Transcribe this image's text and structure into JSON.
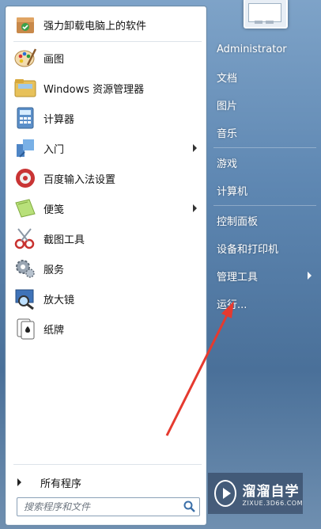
{
  "programs": [
    {
      "label": "强力卸载电脑上的软件",
      "icon": "uninstaller-icon",
      "has_submenu": false
    },
    {
      "label": "画图",
      "icon": "paint-icon",
      "has_submenu": false
    },
    {
      "label": "Windows 资源管理器",
      "icon": "explorer-folder-icon",
      "has_submenu": false
    },
    {
      "label": "计算器",
      "icon": "calculator-icon",
      "has_submenu": false
    },
    {
      "label": "入门",
      "icon": "getting-started-icon",
      "has_submenu": true
    },
    {
      "label": "百度输入法设置",
      "icon": "baidu-ime-icon",
      "has_submenu": false
    },
    {
      "label": "便笺",
      "icon": "sticky-notes-icon",
      "has_submenu": true
    },
    {
      "label": "截图工具",
      "icon": "snipping-tool-icon",
      "has_submenu": false
    },
    {
      "label": "服务",
      "icon": "services-gear-icon",
      "has_submenu": false
    },
    {
      "label": "放大镜",
      "icon": "magnifier-icon",
      "has_submenu": false
    },
    {
      "label": "纸牌",
      "icon": "solitaire-icon",
      "has_submenu": false
    }
  ],
  "all_programs_label": "所有程序",
  "search": {
    "placeholder": "搜索程序和文件"
  },
  "right_menu": [
    {
      "label": "Administrator",
      "has_submenu": false
    },
    {
      "label": "文档",
      "has_submenu": false
    },
    {
      "label": "图片",
      "has_submenu": false
    },
    {
      "label": "音乐",
      "has_submenu": false
    },
    {
      "label": "游戏",
      "has_submenu": false
    },
    {
      "label": "计算机",
      "has_submenu": false
    },
    {
      "label": "控制面板",
      "has_submenu": false
    },
    {
      "label": "设备和打印机",
      "has_submenu": false
    },
    {
      "label": "管理工具",
      "has_submenu": true
    },
    {
      "label": "运行...",
      "has_submenu": false
    }
  ],
  "watermark": {
    "title": "溜溜自学",
    "url": "ZIXUE.3D66.COM"
  },
  "colors": {
    "annotation_arrow": "#e53a2f",
    "right_text": "#ffffff"
  }
}
